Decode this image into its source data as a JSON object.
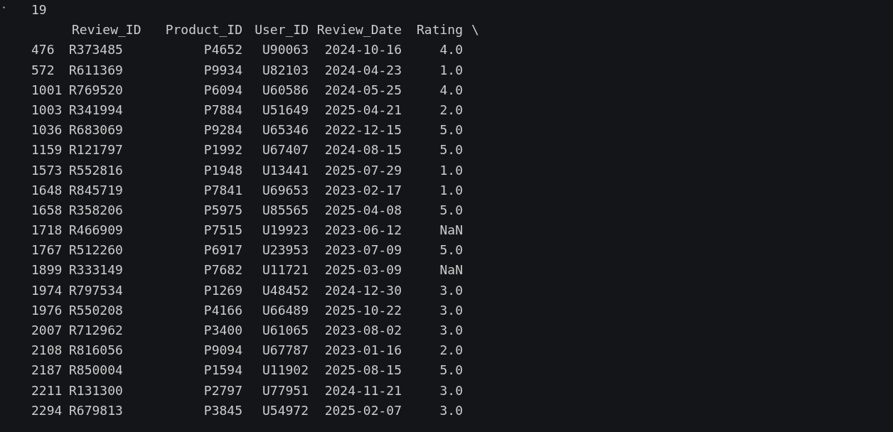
{
  "output": {
    "count": "19",
    "columns": [
      "Review_ID",
      "Product_ID",
      "User_ID",
      "Review_Date",
      "Rating"
    ],
    "continuation": "\\",
    "rows": [
      {
        "index": "476",
        "cells": [
          "R373485",
          "P4652",
          "U90063",
          "2024-10-16",
          "4.0"
        ]
      },
      {
        "index": "572",
        "cells": [
          "R611369",
          "P9934",
          "U82103",
          "2024-04-23",
          "1.0"
        ]
      },
      {
        "index": "1001",
        "cells": [
          "R769520",
          "P6094",
          "U60586",
          "2024-05-25",
          "4.0"
        ]
      },
      {
        "index": "1003",
        "cells": [
          "R341994",
          "P7884",
          "U51649",
          "2025-04-21",
          "2.0"
        ]
      },
      {
        "index": "1036",
        "cells": [
          "R683069",
          "P9284",
          "U65346",
          "2022-12-15",
          "5.0"
        ]
      },
      {
        "index": "1159",
        "cells": [
          "R121797",
          "P1992",
          "U67407",
          "2024-08-15",
          "5.0"
        ]
      },
      {
        "index": "1573",
        "cells": [
          "R552816",
          "P1948",
          "U13441",
          "2025-07-29",
          "1.0"
        ]
      },
      {
        "index": "1648",
        "cells": [
          "R845719",
          "P7841",
          "U69653",
          "2023-02-17",
          "1.0"
        ]
      },
      {
        "index": "1658",
        "cells": [
          "R358206",
          "P5975",
          "U85565",
          "2025-04-08",
          "5.0"
        ]
      },
      {
        "index": "1718",
        "cells": [
          "R466909",
          "P7515",
          "U19923",
          "2023-06-12",
          "NaN"
        ]
      },
      {
        "index": "1767",
        "cells": [
          "R512260",
          "P6917",
          "U23953",
          "2023-07-09",
          "5.0"
        ]
      },
      {
        "index": "1899",
        "cells": [
          "R333149",
          "P7682",
          "U11721",
          "2025-03-09",
          "NaN"
        ]
      },
      {
        "index": "1974",
        "cells": [
          "R797534",
          "P1269",
          "U48452",
          "2024-12-30",
          "3.0"
        ]
      },
      {
        "index": "1976",
        "cells": [
          "R550208",
          "P4166",
          "U66489",
          "2025-10-22",
          "3.0"
        ]
      },
      {
        "index": "2007",
        "cells": [
          "R712962",
          "P3400",
          "U61065",
          "2023-08-02",
          "3.0"
        ]
      },
      {
        "index": "2108",
        "cells": [
          "R816056",
          "P9094",
          "U67787",
          "2023-01-16",
          "2.0"
        ]
      },
      {
        "index": "2187",
        "cells": [
          "R850004",
          "P1594",
          "U11902",
          "2025-08-15",
          "5.0"
        ]
      },
      {
        "index": "2211",
        "cells": [
          "R131300",
          "P2797",
          "U77951",
          "2024-11-21",
          "3.0"
        ]
      },
      {
        "index": "2294",
        "cells": [
          "R679813",
          "P3845",
          "U54972",
          "2025-02-07",
          "3.0"
        ]
      }
    ]
  }
}
